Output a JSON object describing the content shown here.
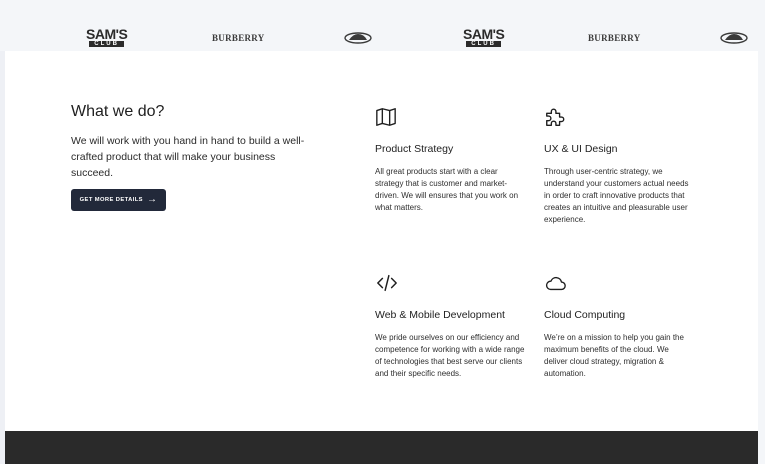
{
  "logos": {
    "sams_top": "SAM'S",
    "sams_bottom": "CLUB",
    "burberry": "BURBERRY"
  },
  "intro": {
    "title": "What we do?",
    "text": "We will work with you hand in hand to build a well-crafted product that will make your business succeed.",
    "cta_label": "GET MORE DETAILS",
    "cta_arrow": "→"
  },
  "services": [
    {
      "icon": "map-icon",
      "title": "Product Strategy",
      "description": "All great products start with a clear strategy that is customer and market-driven. We will ensures that you work on what matters."
    },
    {
      "icon": "puzzle-icon",
      "title": "UX & UI Design",
      "description": "Through user-centric strategy, we understand your customers actual needs in order to craft innovative products that creates an intuitive and pleasurable user experience."
    },
    {
      "icon": "code-icon",
      "title": "Web & Mobile Development",
      "description": "We pride ourselves on our efficiency and competence for working with a wide range of technologies that best serve our clients and their specific needs."
    },
    {
      "icon": "cloud-icon",
      "title": "Cloud Computing",
      "description": "We’re on a mission to help you gain the maximum benefits of the cloud. We deliver cloud strategy, migration & automation."
    }
  ],
  "colors": {
    "cta_background": "#22293a",
    "logo_strip_background": "#f4f6f9",
    "footer_background": "#2a2a2a"
  }
}
